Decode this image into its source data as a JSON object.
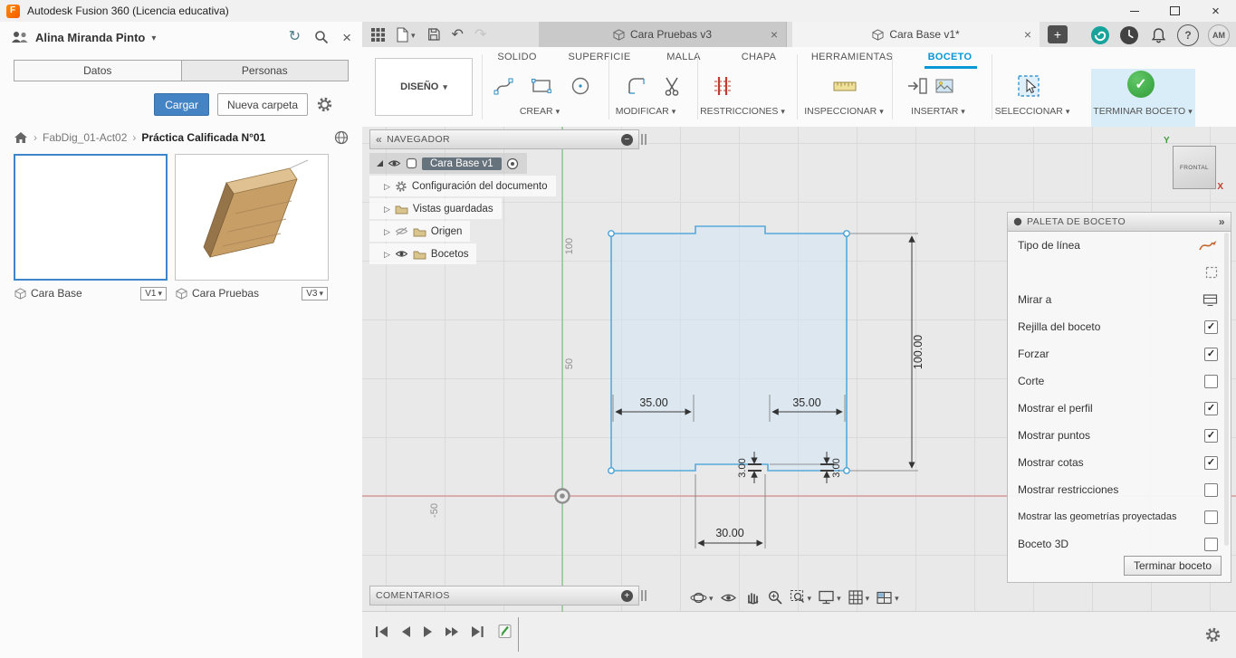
{
  "titlebar": {
    "title": "Autodesk Fusion 360 (Licencia educativa)"
  },
  "data_panel": {
    "user_name": "Alina Miranda Pinto",
    "tabs": {
      "datos": "Datos",
      "personas": "Personas"
    },
    "upload_button": "Cargar",
    "new_folder_button": "Nueva carpeta",
    "breadcrumb": {
      "project": "FabDig_01-Act02",
      "folder": "Práctica Calificada N°01"
    },
    "cards": [
      {
        "name": "Cara Base",
        "version": "V1"
      },
      {
        "name": "Cara Pruebas",
        "version": "V3"
      }
    ]
  },
  "doc_bar": {
    "tab1": "Cara Pruebas v3",
    "tab2": "Cara Base v1*",
    "avatar": "AM"
  },
  "ribbon": {
    "design_menu": "DISEÑO",
    "tabs": [
      {
        "label": "SOLIDO"
      },
      {
        "label": "SUPERFICIE"
      },
      {
        "label": "MALLA"
      },
      {
        "label": "CHAPA"
      },
      {
        "label": "HERRAMIENTAS"
      },
      {
        "label": "BOCETO"
      }
    ],
    "groups": [
      {
        "label": "CREAR"
      },
      {
        "label": "MODIFICAR"
      },
      {
        "label": "RESTRICCIONES"
      },
      {
        "label": "INSPECCIONAR"
      },
      {
        "label": "INSERTAR"
      },
      {
        "label": "SELECCIONAR"
      },
      {
        "label": "TERMINAR BOCETO"
      }
    ]
  },
  "navigator": {
    "title": "NAVEGADOR",
    "root_label": "Cara Base v1",
    "items": [
      {
        "label": "Configuración del documento"
      },
      {
        "label": "Vistas guardadas"
      },
      {
        "label": "Origen"
      },
      {
        "label": "Bocetos"
      }
    ]
  },
  "viewcube": {
    "face": "FRONTAL",
    "axis_y": "Y",
    "axis_x": "X"
  },
  "sketch_palette": {
    "title": "PALETA DE BOCETO",
    "rows": [
      {
        "label": "Tipo de línea",
        "control": "linetype-icon"
      },
      {
        "label": "",
        "control": "construction-icon"
      },
      {
        "label": "Mirar a",
        "control": "look-at-icon"
      },
      {
        "label": "Rejilla del boceto",
        "checked": true
      },
      {
        "label": "Forzar",
        "checked": true
      },
      {
        "label": "Corte",
        "checked": false
      },
      {
        "label": "Mostrar el perfil",
        "checked": true
      },
      {
        "label": "Mostrar puntos",
        "checked": true
      },
      {
        "label": "Mostrar cotas",
        "checked": true
      },
      {
        "label": "Mostrar restricciones",
        "checked": false
      },
      {
        "label": "Mostrar las geometrías proyectadas",
        "checked": false
      },
      {
        "label": "Boceto 3D",
        "checked": false
      }
    ],
    "finish_button": "Terminar boceto"
  },
  "comments": {
    "title": "COMENTARIOS"
  },
  "canvas": {
    "axis_labels": {
      "y100": "100",
      "y50": "50",
      "xneg50": "-50"
    },
    "dims": {
      "left_width": "35.00",
      "right_width": "35.00",
      "height": "100.00",
      "notch_left": "3.00",
      "notch_right": "3.00",
      "bottom_width": "30.00"
    }
  },
  "colors": {
    "accent": "#0998d5",
    "upload_blue": "#4584c4",
    "finish_green": "#2f9c38",
    "sketch_blue": "#57aadb",
    "constraint_red": "#c23b30"
  }
}
